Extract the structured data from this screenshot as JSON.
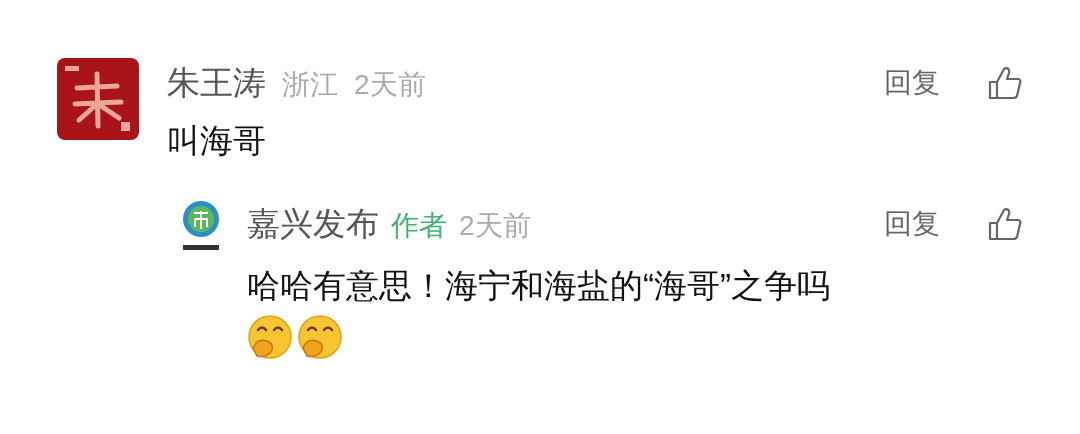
{
  "comments": [
    {
      "author": "朱王涛",
      "region": "浙江",
      "time": "2天前",
      "text": "叫海哥",
      "reply_label": "回复",
      "liked": false,
      "avatar": {
        "kind": "red-square"
      },
      "replies": [
        {
          "author": "嘉兴发布",
          "badge": "作者",
          "time": "2天前",
          "text": "哈哈有意思！海宁和海盐的“海哥”之争吗",
          "reply_label": "回复",
          "liked": false,
          "avatar": {
            "kind": "green-logo"
          },
          "emojis": [
            {
              "kind": "cover-mouth"
            },
            {
              "kind": "cover-mouth"
            }
          ]
        }
      ]
    }
  ]
}
